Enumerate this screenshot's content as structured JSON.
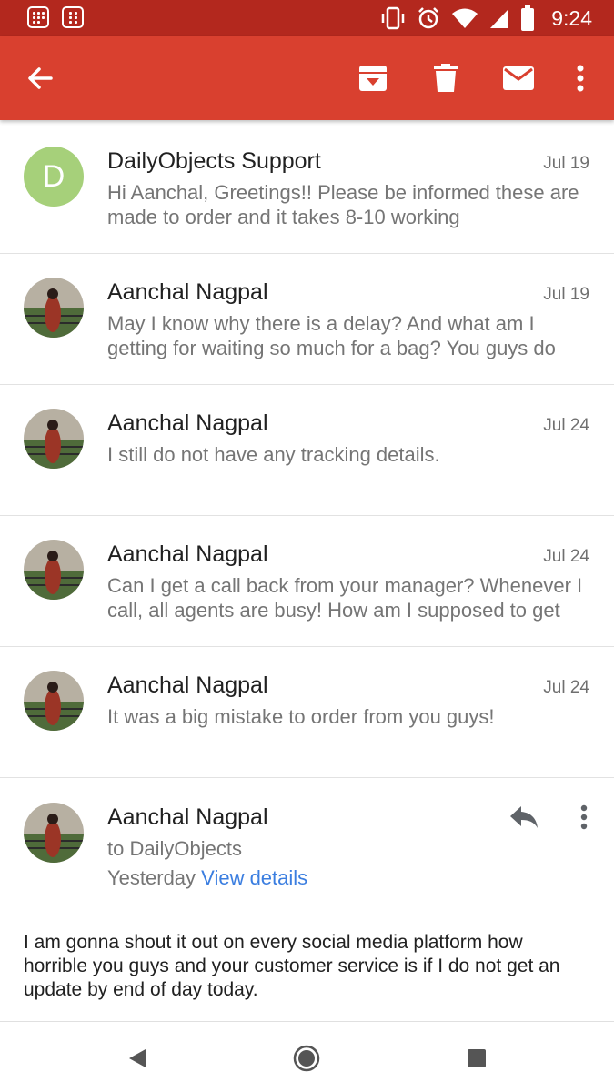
{
  "status_bar": {
    "time": "9:24"
  },
  "toolbar": {
    "back_icon": "arrow-left-icon",
    "archive_icon": "archive-icon",
    "delete_icon": "trash-icon",
    "mark_unread_icon": "mail-icon",
    "more_icon": "more-vert-icon",
    "color": "#d9402f"
  },
  "messages": [
    {
      "sender": "DailyObjects Support",
      "avatar_letter": "D",
      "date": "Jul 19",
      "snippet": "Hi Aanchal, Greetings!! Please be informed these are made to order and it takes 8-10 working"
    },
    {
      "sender": "Aanchal Nagpal",
      "date": "Jul 19",
      "snippet": "May I know why there is a delay? And what am I getting for waiting so much for a bag? You guys do"
    },
    {
      "sender": "Aanchal Nagpal",
      "date": "Jul 24",
      "snippet": "I still do not have any tracking details."
    },
    {
      "sender": "Aanchal Nagpal",
      "date": "Jul 24",
      "snippet": "Can I get a call back from your manager? Whenever I call, all agents are busy! How am I supposed to get"
    },
    {
      "sender": "Aanchal Nagpal",
      "date": "Jul 24",
      "snippet": "It was a big mistake to order from you guys!"
    }
  ],
  "open_message": {
    "sender": "Aanchal Nagpal",
    "to": "to DailyObjects",
    "when": "Yesterday",
    "view_details": "View details",
    "body": "I am gonna shout it out on every social media platform how horrible you guys and your customer service is if I do not get an update by end of day today."
  }
}
